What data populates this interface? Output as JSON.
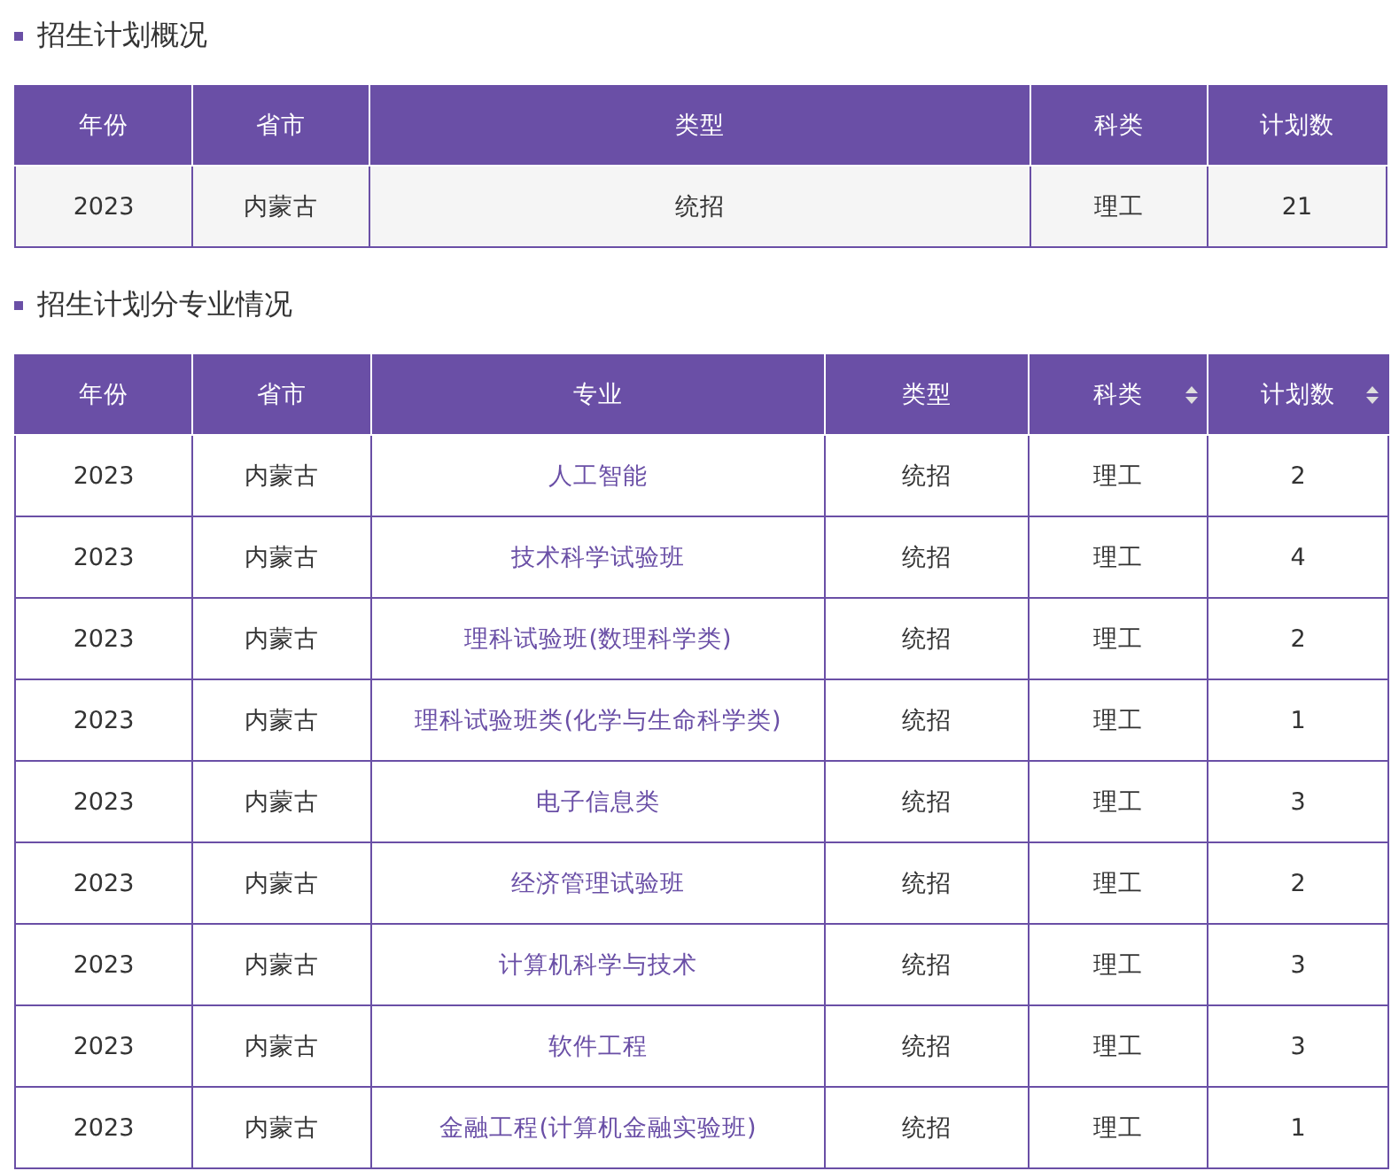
{
  "sections": [
    {
      "title": "招生计划概况",
      "columns": [
        {
          "label": "年份",
          "kind": "text",
          "sortable": false
        },
        {
          "label": "省市",
          "kind": "text",
          "sortable": false
        },
        {
          "label": "类型",
          "kind": "text",
          "sortable": false
        },
        {
          "label": "科类",
          "kind": "text",
          "sortable": false
        },
        {
          "label": "计划数",
          "kind": "text",
          "sortable": false
        }
      ],
      "rows": [
        [
          "2023",
          "内蒙古",
          "统招",
          "理工",
          "21"
        ]
      ]
    },
    {
      "title": "招生计划分专业情况",
      "columns": [
        {
          "label": "年份",
          "kind": "text",
          "sortable": false
        },
        {
          "label": "省市",
          "kind": "text",
          "sortable": false
        },
        {
          "label": "专业",
          "kind": "link",
          "sortable": false
        },
        {
          "label": "类型",
          "kind": "text",
          "sortable": false
        },
        {
          "label": "科类",
          "kind": "text",
          "sortable": true
        },
        {
          "label": "计划数",
          "kind": "text",
          "sortable": true
        }
      ],
      "rows": [
        [
          "2023",
          "内蒙古",
          "人工智能",
          "统招",
          "理工",
          "2"
        ],
        [
          "2023",
          "内蒙古",
          "技术科学试验班",
          "统招",
          "理工",
          "4"
        ],
        [
          "2023",
          "内蒙古",
          "理科试验班(数理科学类)",
          "统招",
          "理工",
          "2"
        ],
        [
          "2023",
          "内蒙古",
          "理科试验班类(化学与生命科学类)",
          "统招",
          "理工",
          "1"
        ],
        [
          "2023",
          "内蒙古",
          "电子信息类",
          "统招",
          "理工",
          "3"
        ],
        [
          "2023",
          "内蒙古",
          "经济管理试验班",
          "统招",
          "理工",
          "2"
        ],
        [
          "2023",
          "内蒙古",
          "计算机科学与技术",
          "统招",
          "理工",
          "3"
        ],
        [
          "2023",
          "内蒙古",
          "软件工程",
          "统招",
          "理工",
          "3"
        ],
        [
          "2023",
          "内蒙古",
          "金融工程(计算机金融实验班)",
          "统招",
          "理工",
          "1"
        ]
      ]
    }
  ]
}
